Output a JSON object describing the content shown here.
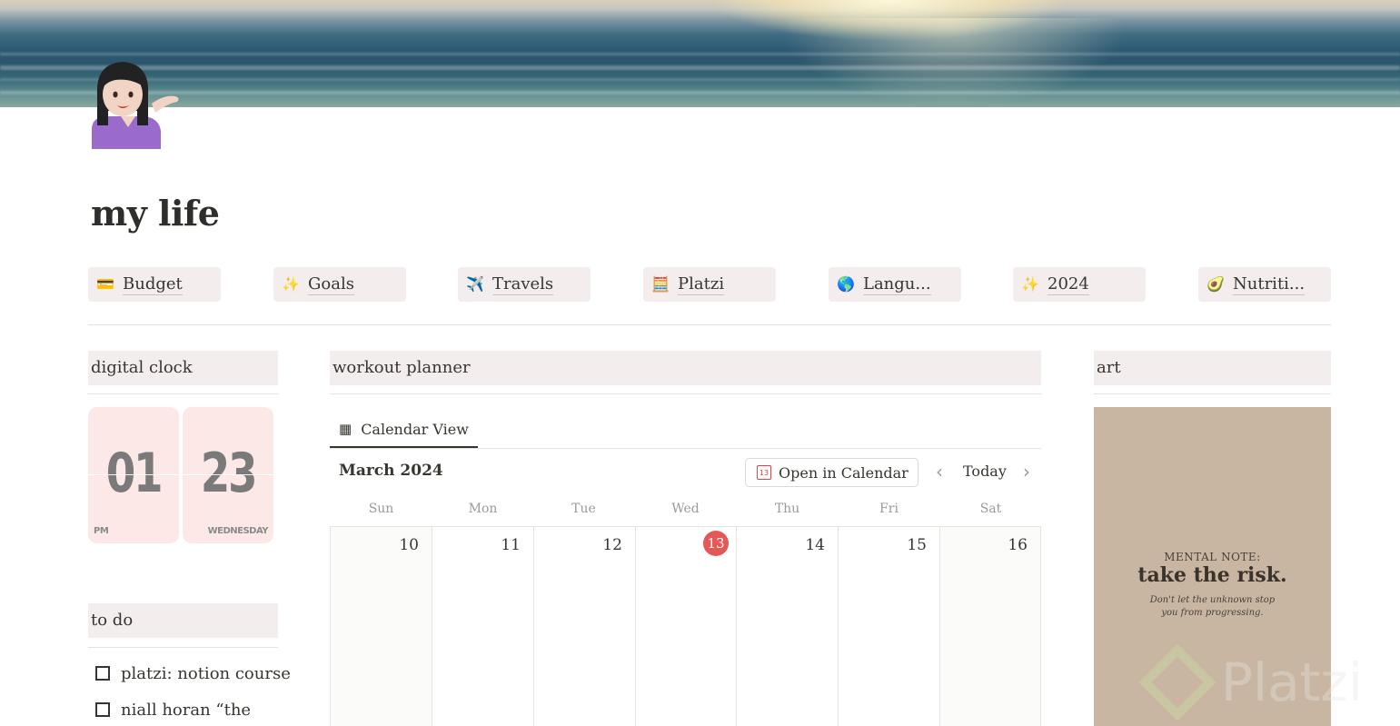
{
  "page": {
    "title": "my life"
  },
  "links": [
    {
      "label": "Budget",
      "icon": "credit-card-icon",
      "glyph": "💳"
    },
    {
      "label": "Goals",
      "icon": "sparkles-icon",
      "glyph": "✨"
    },
    {
      "label": "Travels",
      "icon": "airplane-icon",
      "glyph": "✈️"
    },
    {
      "label": "Platzi",
      "icon": "calculator-icon",
      "glyph": "🧮"
    },
    {
      "label": "Langu...",
      "icon": "globe-icon",
      "glyph": "🌎"
    },
    {
      "label": "2024",
      "icon": "sparkles-icon",
      "glyph": "✨"
    },
    {
      "label": "Nutriti...",
      "icon": "avocado-icon",
      "glyph": "🥑"
    }
  ],
  "clock": {
    "header": "digital clock",
    "hours": "01",
    "minutes": "23",
    "period": "PM",
    "weekday": "WEDNESDAY"
  },
  "todo": {
    "header": "to do",
    "items": [
      {
        "text": "platzi: notion course",
        "checked": false
      },
      {
        "text": "niall horan “the",
        "checked": false
      }
    ]
  },
  "workout": {
    "header": "workout planner",
    "view_tab": "Calendar View",
    "month_label": "March 2024",
    "open_button": "Open in Calendar",
    "open_button_icon_text": "13",
    "today_label": "Today",
    "weekdays": [
      "Sun",
      "Mon",
      "Tue",
      "Wed",
      "Thu",
      "Fri",
      "Sat"
    ],
    "days": [
      "10",
      "11",
      "12",
      "13",
      "14",
      "15",
      "16"
    ],
    "today_index": 3,
    "accent_color": "#e55858"
  },
  "art": {
    "header": "art",
    "line1": "MENTAL NOTE:",
    "line2": "take the risk.",
    "line3a": "Don't let the unknown stop",
    "line3b": "you from progressing."
  },
  "watermark": {
    "text": "Platzi"
  }
}
